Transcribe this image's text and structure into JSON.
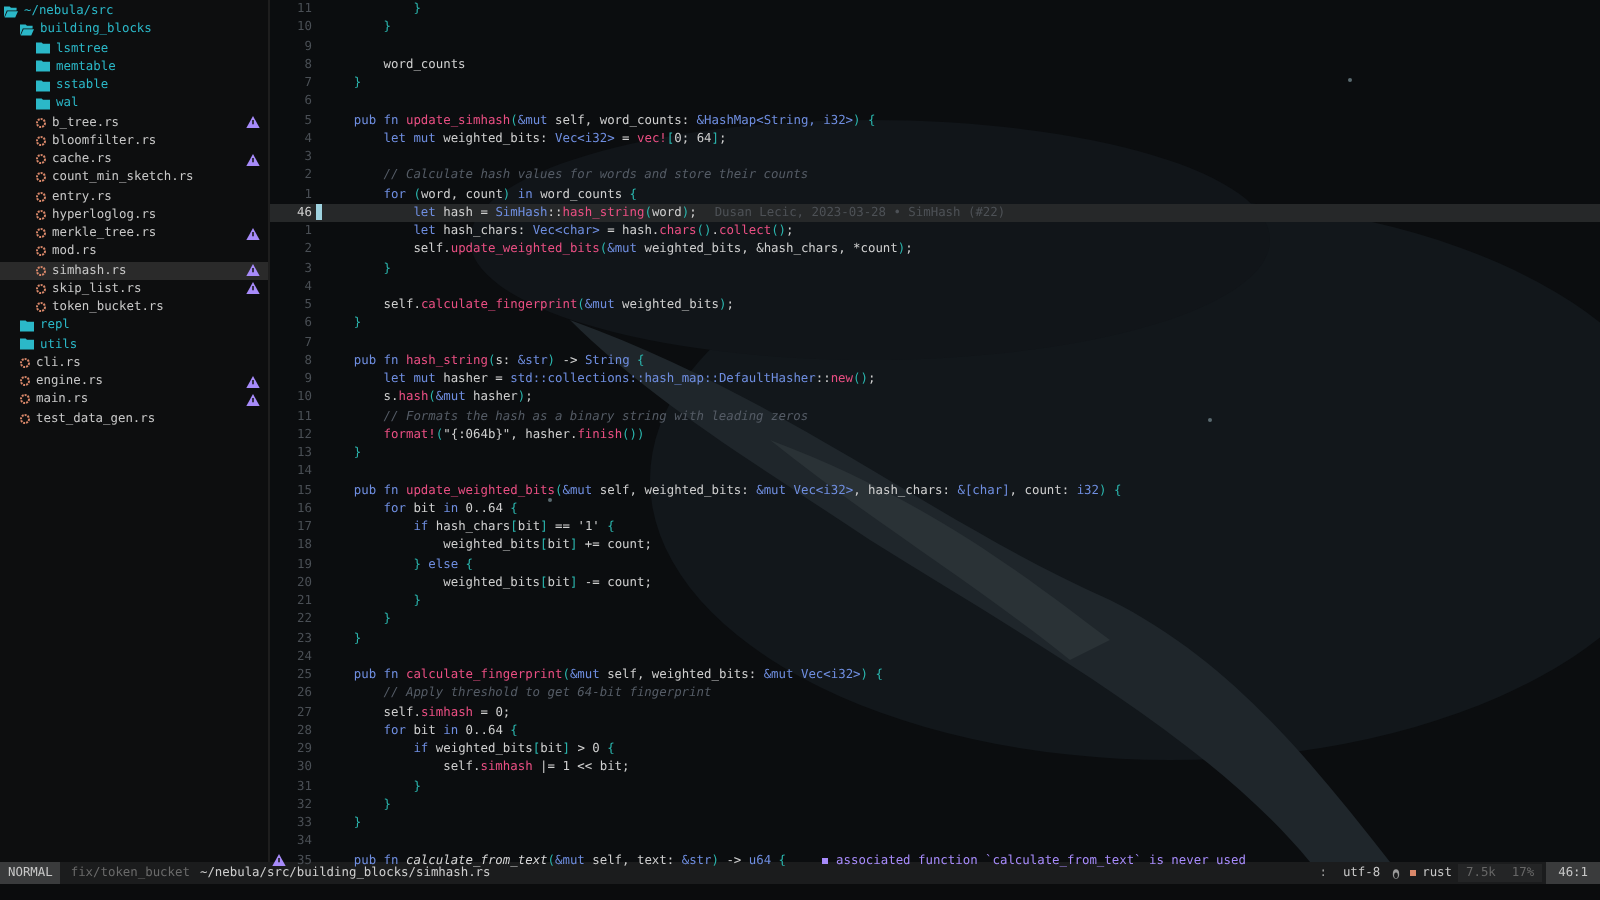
{
  "sidebar": {
    "root": {
      "name": "~/nebula/src",
      "kind": "folder",
      "expanded": true,
      "selected": false,
      "warning": false,
      "children": [
        {
          "name": "building_blocks",
          "kind": "folder",
          "expanded": true,
          "selected": false,
          "warning": false,
          "children": [
            {
              "name": "lsmtree",
              "kind": "folder",
              "expanded": false,
              "selected": false,
              "warning": false
            },
            {
              "name": "memtable",
              "kind": "folder",
              "expanded": false,
              "selected": false,
              "warning": false
            },
            {
              "name": "sstable",
              "kind": "folder",
              "expanded": false,
              "selected": false,
              "warning": false
            },
            {
              "name": "wal",
              "kind": "folder",
              "expanded": false,
              "selected": false,
              "warning": false
            },
            {
              "name": "b_tree.rs",
              "kind": "file",
              "selected": false,
              "warning": true
            },
            {
              "name": "bloomfilter.rs",
              "kind": "file",
              "selected": false,
              "warning": false
            },
            {
              "name": "cache.rs",
              "kind": "file",
              "selected": false,
              "warning": true
            },
            {
              "name": "count_min_sketch.rs",
              "kind": "file",
              "selected": false,
              "warning": false
            },
            {
              "name": "entry.rs",
              "kind": "file",
              "selected": false,
              "warning": false
            },
            {
              "name": "hyperloglog.rs",
              "kind": "file",
              "selected": false,
              "warning": false
            },
            {
              "name": "merkle_tree.rs",
              "kind": "file",
              "selected": false,
              "warning": true
            },
            {
              "name": "mod.rs",
              "kind": "file",
              "selected": false,
              "warning": false
            },
            {
              "name": "simhash.rs",
              "kind": "file",
              "selected": true,
              "warning": true
            },
            {
              "name": "skip_list.rs",
              "kind": "file",
              "selected": false,
              "warning": true
            },
            {
              "name": "token_bucket.rs",
              "kind": "file",
              "selected": false,
              "warning": false
            }
          ]
        },
        {
          "name": "repl",
          "kind": "folder",
          "expanded": false,
          "selected": false,
          "warning": false
        },
        {
          "name": "utils",
          "kind": "folder",
          "expanded": false,
          "selected": false,
          "warning": false
        },
        {
          "name": "cli.rs",
          "kind": "file",
          "selected": false,
          "warning": false
        },
        {
          "name": "engine.rs",
          "kind": "file",
          "selected": false,
          "warning": true
        },
        {
          "name": "main.rs",
          "kind": "file",
          "selected": false,
          "warning": true
        },
        {
          "name": "test_data_gen.rs",
          "kind": "file",
          "selected": false,
          "warning": false
        }
      ]
    }
  },
  "editor": {
    "lines": [
      {
        "number": "11",
        "current": false,
        "warning": false,
        "tokens": [
          {
            "kind": "brace",
            "text": "            }"
          }
        ]
      },
      {
        "number": "10",
        "current": false,
        "warning": false,
        "tokens": [
          {
            "kind": "brace",
            "text": "        }"
          }
        ]
      },
      {
        "number": "9",
        "current": false,
        "warning": false
      },
      {
        "number": "8",
        "current": false,
        "warning": false,
        "tokens": [
          {
            "kind": "plain",
            "text": "        word_counts"
          }
        ]
      },
      {
        "number": "7",
        "current": false,
        "warning": false,
        "tokens": [
          {
            "kind": "brace",
            "text": "    }"
          }
        ]
      },
      {
        "number": "6",
        "current": false,
        "warning": false
      },
      {
        "number": "5",
        "current": false,
        "warning": false,
        "tokens": [
          {
            "kind": "keyword",
            "text": "    pub fn "
          },
          {
            "kind": "function",
            "text": "update_simhash"
          },
          {
            "kind": "brace",
            "text": "("
          },
          {
            "kind": "keyword",
            "text": "&mut"
          },
          {
            "kind": "plain",
            "text": " self, word_counts: "
          },
          {
            "kind": "type",
            "text": "&HashMap<String, i32>"
          },
          {
            "kind": "brace",
            "text": ") {"
          }
        ]
      },
      {
        "number": "4",
        "current": false,
        "warning": false,
        "tokens": [
          {
            "kind": "keyword",
            "text": "        let mut "
          },
          {
            "kind": "plain",
            "text": "weighted_bits: "
          },
          {
            "kind": "type",
            "text": "Vec<i32>"
          },
          {
            "kind": "plain",
            "text": " = "
          },
          {
            "kind": "function",
            "text": "vec!"
          },
          {
            "kind": "brace",
            "text": "["
          },
          {
            "kind": "plain",
            "text": "0; 64"
          },
          {
            "kind": "brace",
            "text": "]"
          },
          {
            "kind": "plain",
            "text": ";"
          }
        ]
      },
      {
        "number": "3",
        "current": false,
        "warning": false
      },
      {
        "number": "2",
        "current": false,
        "warning": false,
        "tokens": [
          {
            "kind": "comment",
            "text": "        // Calculate hash values for words and store their counts"
          }
        ]
      },
      {
        "number": "1",
        "current": false,
        "warning": false,
        "tokens": [
          {
            "kind": "keyword",
            "text": "        for "
          },
          {
            "kind": "brace",
            "text": "("
          },
          {
            "kind": "plain",
            "text": "word, count"
          },
          {
            "kind": "brace",
            "text": ")"
          },
          {
            "kind": "keyword",
            "text": " in "
          },
          {
            "kind": "plain",
            "text": "word_counts "
          },
          {
            "kind": "brace",
            "text": "{"
          }
        ]
      },
      {
        "number": "46",
        "current": true,
        "warning": false,
        "blame": "Dusan Lecic, 2023-03-28 • SimHash (#22)",
        "tokens": [
          {
            "kind": "keyword",
            "text": "            let "
          },
          {
            "kind": "plain",
            "text": "hash = "
          },
          {
            "kind": "type",
            "text": "SimHash"
          },
          {
            "kind": "plain",
            "text": "::"
          },
          {
            "kind": "function",
            "text": "hash_string"
          },
          {
            "kind": "brace",
            "text": "("
          },
          {
            "kind": "plain",
            "text": "word"
          },
          {
            "kind": "brace",
            "text": ")"
          },
          {
            "kind": "plain",
            "text": ";"
          }
        ]
      },
      {
        "number": "1",
        "current": false,
        "warning": false,
        "tokens": [
          {
            "kind": "keyword",
            "text": "            let "
          },
          {
            "kind": "plain",
            "text": "hash_chars: "
          },
          {
            "kind": "type",
            "text": "Vec<char>"
          },
          {
            "kind": "plain",
            "text": " = hash."
          },
          {
            "kind": "function",
            "text": "chars"
          },
          {
            "kind": "brace",
            "text": "()"
          },
          {
            "kind": "plain",
            "text": "."
          },
          {
            "kind": "function",
            "text": "collect"
          },
          {
            "kind": "brace",
            "text": "()"
          },
          {
            "kind": "plain",
            "text": ";"
          }
        ]
      },
      {
        "number": "2",
        "current": false,
        "warning": false,
        "tokens": [
          {
            "kind": "plain",
            "text": "            self."
          },
          {
            "kind": "function",
            "text": "update_weighted_bits"
          },
          {
            "kind": "brace",
            "text": "("
          },
          {
            "kind": "keyword",
            "text": "&mut"
          },
          {
            "kind": "plain",
            "text": " weighted_bits, &hash_chars, *count"
          },
          {
            "kind": "brace",
            "text": ")"
          },
          {
            "kind": "plain",
            "text": ";"
          }
        ]
      },
      {
        "number": "3",
        "current": false,
        "warning": false,
        "tokens": [
          {
            "kind": "brace",
            "text": "        }"
          }
        ]
      },
      {
        "number": "4",
        "current": false,
        "warning": false
      },
      {
        "number": "5",
        "current": false,
        "warning": false,
        "tokens": [
          {
            "kind": "plain",
            "text": "        self."
          },
          {
            "kind": "function",
            "text": "calculate_fingerprint"
          },
          {
            "kind": "brace",
            "text": "("
          },
          {
            "kind": "keyword",
            "text": "&mut"
          },
          {
            "kind": "plain",
            "text": " weighted_bits"
          },
          {
            "kind": "brace",
            "text": ")"
          },
          {
            "kind": "plain",
            "text": ";"
          }
        ]
      },
      {
        "number": "6",
        "current": false,
        "warning": false,
        "tokens": [
          {
            "kind": "brace",
            "text": "    }"
          }
        ]
      },
      {
        "number": "7",
        "current": false,
        "warning": false
      },
      {
        "number": "8",
        "current": false,
        "warning": false,
        "tokens": [
          {
            "kind": "keyword",
            "text": "    pub fn "
          },
          {
            "kind": "function",
            "text": "hash_string"
          },
          {
            "kind": "brace",
            "text": "("
          },
          {
            "kind": "plain",
            "text": "s: "
          },
          {
            "kind": "keyword",
            "text": "&str"
          },
          {
            "kind": "brace",
            "text": ")"
          },
          {
            "kind": "plain",
            "text": " -> "
          },
          {
            "kind": "type",
            "text": "String"
          },
          {
            "kind": "brace",
            "text": " {"
          }
        ]
      },
      {
        "number": "9",
        "current": false,
        "warning": false,
        "tokens": [
          {
            "kind": "keyword",
            "text": "        let mut "
          },
          {
            "kind": "plain",
            "text": "hasher = "
          },
          {
            "kind": "type",
            "text": "std::collections::hash_map::DefaultHasher"
          },
          {
            "kind": "plain",
            "text": "::"
          },
          {
            "kind": "function",
            "text": "new"
          },
          {
            "kind": "brace",
            "text": "()"
          },
          {
            "kind": "plain",
            "text": ";"
          }
        ]
      },
      {
        "number": "10",
        "current": false,
        "warning": false,
        "tokens": [
          {
            "kind": "plain",
            "text": "        s."
          },
          {
            "kind": "function",
            "text": "hash"
          },
          {
            "kind": "brace",
            "text": "("
          },
          {
            "kind": "keyword",
            "text": "&mut"
          },
          {
            "kind": "plain",
            "text": " hasher"
          },
          {
            "kind": "brace",
            "text": ")"
          },
          {
            "kind": "plain",
            "text": ";"
          }
        ]
      },
      {
        "number": "11",
        "current": false,
        "warning": false,
        "tokens": [
          {
            "kind": "comment",
            "text": "        // Formats the hash as a binary string with leading zeros"
          }
        ]
      },
      {
        "number": "12",
        "current": false,
        "warning": false,
        "tokens": [
          {
            "kind": "function",
            "text": "        format!"
          },
          {
            "kind": "brace",
            "text": "("
          },
          {
            "kind": "plain",
            "text": "\"{:064b}\", hasher."
          },
          {
            "kind": "function",
            "text": "finish"
          },
          {
            "kind": "brace",
            "text": "())"
          }
        ]
      },
      {
        "number": "13",
        "current": false,
        "warning": false,
        "tokens": [
          {
            "kind": "brace",
            "text": "    }"
          }
        ]
      },
      {
        "number": "14",
        "current": false,
        "warning": false
      },
      {
        "number": "15",
        "current": false,
        "warning": false,
        "tokens": [
          {
            "kind": "keyword",
            "text": "    pub fn "
          },
          {
            "kind": "function",
            "text": "update_weighted_bits"
          },
          {
            "kind": "brace",
            "text": "("
          },
          {
            "kind": "keyword",
            "text": "&mut"
          },
          {
            "kind": "plain",
            "text": " self, weighted_bits: "
          },
          {
            "kind": "keyword",
            "text": "&mut "
          },
          {
            "kind": "type",
            "text": "Vec<i32>"
          },
          {
            "kind": "plain",
            "text": ", hash_chars: "
          },
          {
            "kind": "type",
            "text": "&[char]"
          },
          {
            "kind": "plain",
            "text": ", count: "
          },
          {
            "kind": "type",
            "text": "i32"
          },
          {
            "kind": "brace",
            "text": ") {"
          }
        ]
      },
      {
        "number": "16",
        "current": false,
        "warning": false,
        "tokens": [
          {
            "kind": "keyword",
            "text": "        for "
          },
          {
            "kind": "plain",
            "text": "bit "
          },
          {
            "kind": "keyword",
            "text": "in "
          },
          {
            "kind": "plain",
            "text": "0..64 "
          },
          {
            "kind": "brace",
            "text": "{"
          }
        ]
      },
      {
        "number": "17",
        "current": false,
        "warning": false,
        "tokens": [
          {
            "kind": "keyword",
            "text": "            if "
          },
          {
            "kind": "plain",
            "text": "hash_chars"
          },
          {
            "kind": "brace",
            "text": "["
          },
          {
            "kind": "plain",
            "text": "bit"
          },
          {
            "kind": "brace",
            "text": "]"
          },
          {
            "kind": "plain",
            "text": " == '1' "
          },
          {
            "kind": "brace",
            "text": "{"
          }
        ]
      },
      {
        "number": "18",
        "current": false,
        "warning": false,
        "tokens": [
          {
            "kind": "plain",
            "text": "                weighted_bits"
          },
          {
            "kind": "brace",
            "text": "["
          },
          {
            "kind": "plain",
            "text": "bit"
          },
          {
            "kind": "brace",
            "text": "]"
          },
          {
            "kind": "plain",
            "text": " += count;"
          }
        ]
      },
      {
        "number": "19",
        "current": false,
        "warning": false,
        "tokens": [
          {
            "kind": "brace",
            "text": "            }"
          },
          {
            "kind": "keyword",
            "text": " else "
          },
          {
            "kind": "brace",
            "text": "{"
          }
        ]
      },
      {
        "number": "20",
        "current": false,
        "warning": false,
        "tokens": [
          {
            "kind": "plain",
            "text": "                weighted_bits"
          },
          {
            "kind": "brace",
            "text": "["
          },
          {
            "kind": "plain",
            "text": "bit"
          },
          {
            "kind": "brace",
            "text": "]"
          },
          {
            "kind": "plain",
            "text": " -= count;"
          }
        ]
      },
      {
        "number": "21",
        "current": false,
        "warning": false,
        "tokens": [
          {
            "kind": "brace",
            "text": "            }"
          }
        ]
      },
      {
        "number": "22",
        "current": false,
        "warning": false,
        "tokens": [
          {
            "kind": "brace",
            "text": "        }"
          }
        ]
      },
      {
        "number": "23",
        "current": false,
        "warning": false,
        "tokens": [
          {
            "kind": "brace",
            "text": "    }"
          }
        ]
      },
      {
        "number": "24",
        "current": false,
        "warning": false
      },
      {
        "number": "25",
        "current": false,
        "warning": false,
        "tokens": [
          {
            "kind": "keyword",
            "text": "    pub fn "
          },
          {
            "kind": "function",
            "text": "calculate_fingerprint"
          },
          {
            "kind": "brace",
            "text": "("
          },
          {
            "kind": "keyword",
            "text": "&mut"
          },
          {
            "kind": "plain",
            "text": " self, weighted_bits: "
          },
          {
            "kind": "keyword",
            "text": "&mut "
          },
          {
            "kind": "type",
            "text": "Vec<i32>"
          },
          {
            "kind": "brace",
            "text": ") {"
          }
        ]
      },
      {
        "number": "26",
        "current": false,
        "warning": false,
        "tokens": [
          {
            "kind": "comment",
            "text": "        // Apply threshold to get 64-bit fingerprint"
          }
        ]
      },
      {
        "number": "27",
        "current": false,
        "warning": false,
        "tokens": [
          {
            "kind": "plain",
            "text": "        self."
          },
          {
            "kind": "function",
            "text": "simhash"
          },
          {
            "kind": "plain",
            "text": " = 0;"
          }
        ]
      },
      {
        "number": "28",
        "current": false,
        "warning": false,
        "tokens": [
          {
            "kind": "keyword",
            "text": "        for "
          },
          {
            "kind": "plain",
            "text": "bit "
          },
          {
            "kind": "keyword",
            "text": "in "
          },
          {
            "kind": "plain",
            "text": "0..64 "
          },
          {
            "kind": "brace",
            "text": "{"
          }
        ]
      },
      {
        "number": "29",
        "current": false,
        "warning": false,
        "tokens": [
          {
            "kind": "keyword",
            "text": "            if "
          },
          {
            "kind": "plain",
            "text": "weighted_bits"
          },
          {
            "kind": "brace",
            "text": "["
          },
          {
            "kind": "plain",
            "text": "bit"
          },
          {
            "kind": "brace",
            "text": "]"
          },
          {
            "kind": "plain",
            "text": " > 0 "
          },
          {
            "kind": "brace",
            "text": "{"
          }
        ]
      },
      {
        "number": "30",
        "current": false,
        "warning": false,
        "tokens": [
          {
            "kind": "plain",
            "text": "                self."
          },
          {
            "kind": "function",
            "text": "simhash"
          },
          {
            "kind": "plain",
            "text": " |= 1 << bit;"
          }
        ]
      },
      {
        "number": "31",
        "current": false,
        "warning": false,
        "tokens": [
          {
            "kind": "brace",
            "text": "            }"
          }
        ]
      },
      {
        "number": "32",
        "current": false,
        "warning": false,
        "tokens": [
          {
            "kind": "brace",
            "text": "        }"
          }
        ]
      },
      {
        "number": "33",
        "current": false,
        "warning": false,
        "tokens": [
          {
            "kind": "brace",
            "text": "    }"
          }
        ]
      },
      {
        "number": "34",
        "current": false,
        "warning": false
      },
      {
        "number": "35",
        "current": false,
        "warning": true,
        "diagnostic": "associated function `calculate_from_text` is never used",
        "tokens": [
          {
            "kind": "keyword",
            "text": "    pub fn "
          },
          {
            "kind": "italic",
            "text": "calculate_from_text"
          },
          {
            "kind": "brace",
            "text": "("
          },
          {
            "kind": "keyword",
            "text": "&mut"
          },
          {
            "kind": "plain",
            "text": " self, text: "
          },
          {
            "kind": "keyword",
            "text": "&str"
          },
          {
            "kind": "brace",
            "text": ")"
          },
          {
            "kind": "plain",
            "text": " -> "
          },
          {
            "kind": "type",
            "text": "u64"
          },
          {
            "kind": "brace",
            "text": " {"
          }
        ]
      }
    ]
  },
  "status_bar": {
    "mode": "NORMAL",
    "branch": "fix/token_bucket",
    "path": "~/nebula/src/building_blocks/simhash.rs",
    "separator": ":",
    "encoding": "utf-8",
    "language": "rust",
    "size": "7.5k",
    "percent": "17%",
    "position": "46:1"
  }
}
